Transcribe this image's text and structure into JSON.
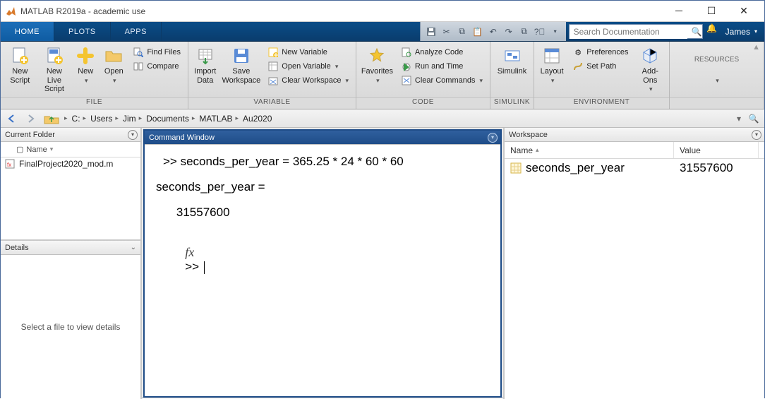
{
  "window": {
    "title": "MATLAB R2019a - academic use"
  },
  "tabs": {
    "home": "HOME",
    "plots": "PLOTS",
    "apps": "APPS"
  },
  "search": {
    "placeholder": "Search Documentation"
  },
  "user": {
    "name": "James"
  },
  "ribbon": {
    "new_script": "New\nScript",
    "new_live_script": "New\nLive Script",
    "new": "New",
    "open": "Open",
    "find_files": "Find Files",
    "compare": "Compare",
    "import_data": "Import\nData",
    "save_workspace": "Save\nWorkspace",
    "new_variable": "New Variable",
    "open_variable": "Open Variable",
    "clear_workspace": "Clear Workspace",
    "favorites": "Favorites",
    "analyze_code": "Analyze Code",
    "run_and_time": "Run and Time",
    "clear_commands": "Clear Commands",
    "simulink": "Simulink",
    "layout": "Layout",
    "preferences": "Preferences",
    "set_path": "Set Path",
    "addons": "Add-Ons",
    "resources": "RESOURCES",
    "group_file": "FILE",
    "group_variable": "VARIABLE",
    "group_code": "CODE",
    "group_simulink": "SIMULINK",
    "group_environment": "ENVIRONMENT"
  },
  "address": {
    "segments": [
      "C:",
      "Users",
      "Jim",
      "Documents",
      "MATLAB",
      "Au2020"
    ]
  },
  "panels": {
    "current_folder": "Current Folder",
    "details": "Details",
    "command_window": "Command Window",
    "workspace": "Workspace",
    "name_header": "Name",
    "name_col": "Name",
    "value_col": "Value",
    "details_empty": "Select a file to view details"
  },
  "files": [
    {
      "name": "FinalProject2020_mod.m"
    }
  ],
  "command": {
    "input_line": ">> seconds_per_year = 365.25 * 24 * 60 * 60",
    "echo_name": "seconds_per_year =",
    "echo_value": "    31557600",
    "prompt": ">> "
  },
  "workspace_vars": [
    {
      "name": "seconds_per_year",
      "value": "31557600"
    }
  ]
}
